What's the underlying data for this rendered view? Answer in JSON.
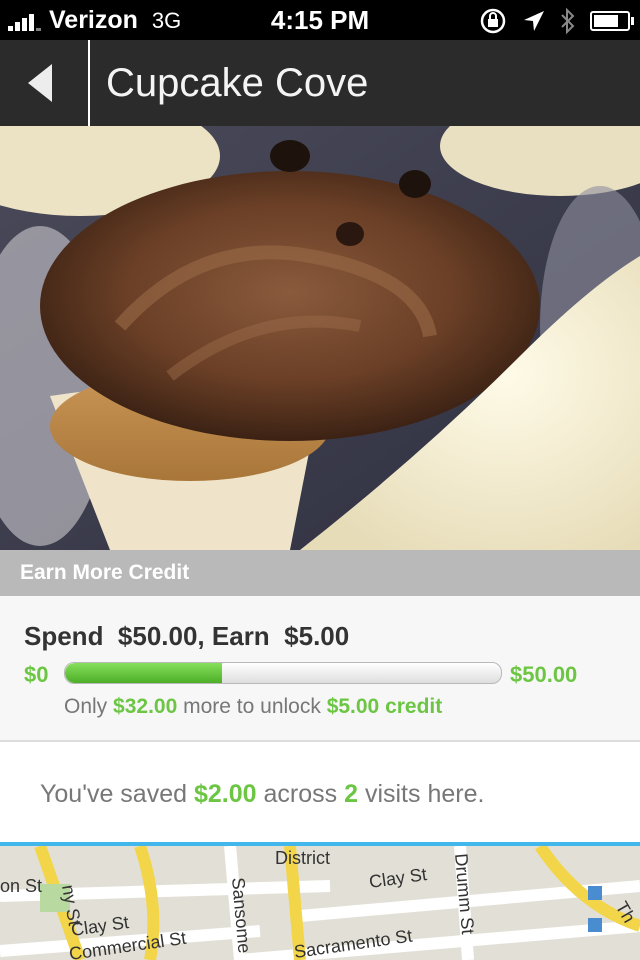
{
  "status_bar": {
    "carrier": "Verizon",
    "network": "3G",
    "time": "4:15 PM"
  },
  "nav": {
    "title": "Cupcake Cove"
  },
  "section": {
    "title": "Earn More Credit"
  },
  "offer": {
    "spend_label": "Spend",
    "spend_amount": "$50.00,",
    "earn_label": "Earn",
    "earn_amount": "$5.00",
    "min_label": "$0",
    "max_label": "$50.00",
    "progress_fraction": 0.36,
    "unlock_prefix": "Only",
    "remaining": "$32.00",
    "unlock_middle": "more to unlock",
    "reward": "$5.00 credit"
  },
  "savings": {
    "prefix": "You've saved",
    "amount": "$2.00",
    "middle": "across",
    "visits": "2",
    "suffix": "visits here."
  },
  "map": {
    "labels": [
      "District",
      "on St",
      "ny St",
      "Clay St",
      "Sansome",
      "Clay St",
      "Drumm St",
      "Commercial St",
      "Sacramento St",
      "Th"
    ]
  }
}
